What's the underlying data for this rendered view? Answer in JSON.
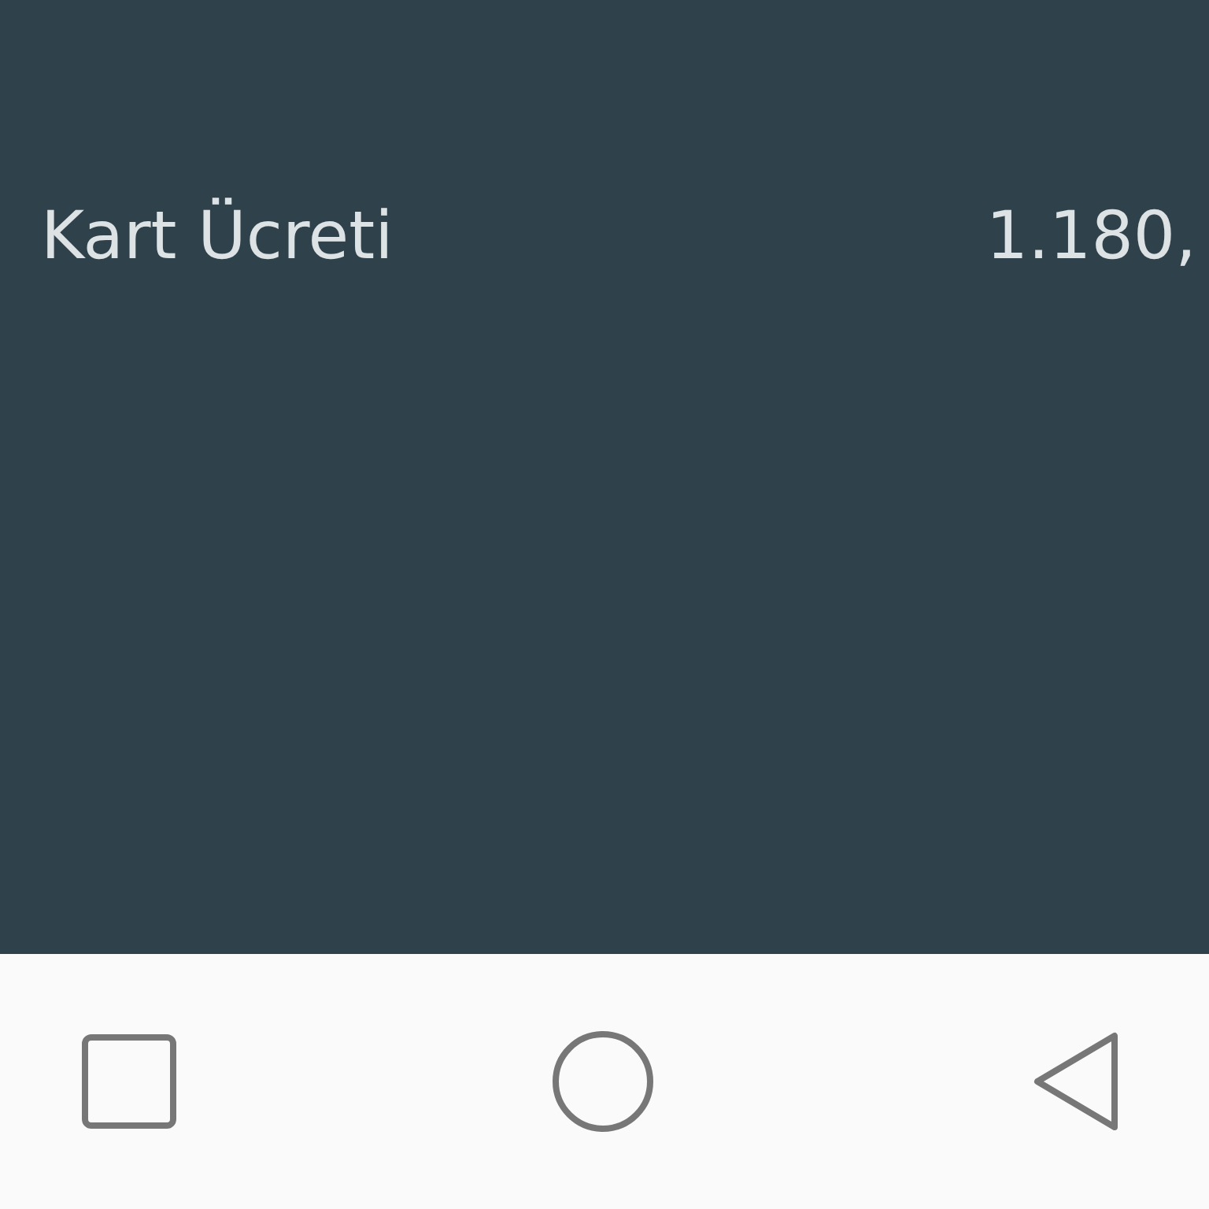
{
  "row": {
    "label": "Kart Ücreti",
    "amount": "1.180,"
  },
  "nav_bar": {
    "buttons": [
      {
        "kind": "recents"
      },
      {
        "kind": "home"
      },
      {
        "kind": "back"
      }
    ]
  }
}
